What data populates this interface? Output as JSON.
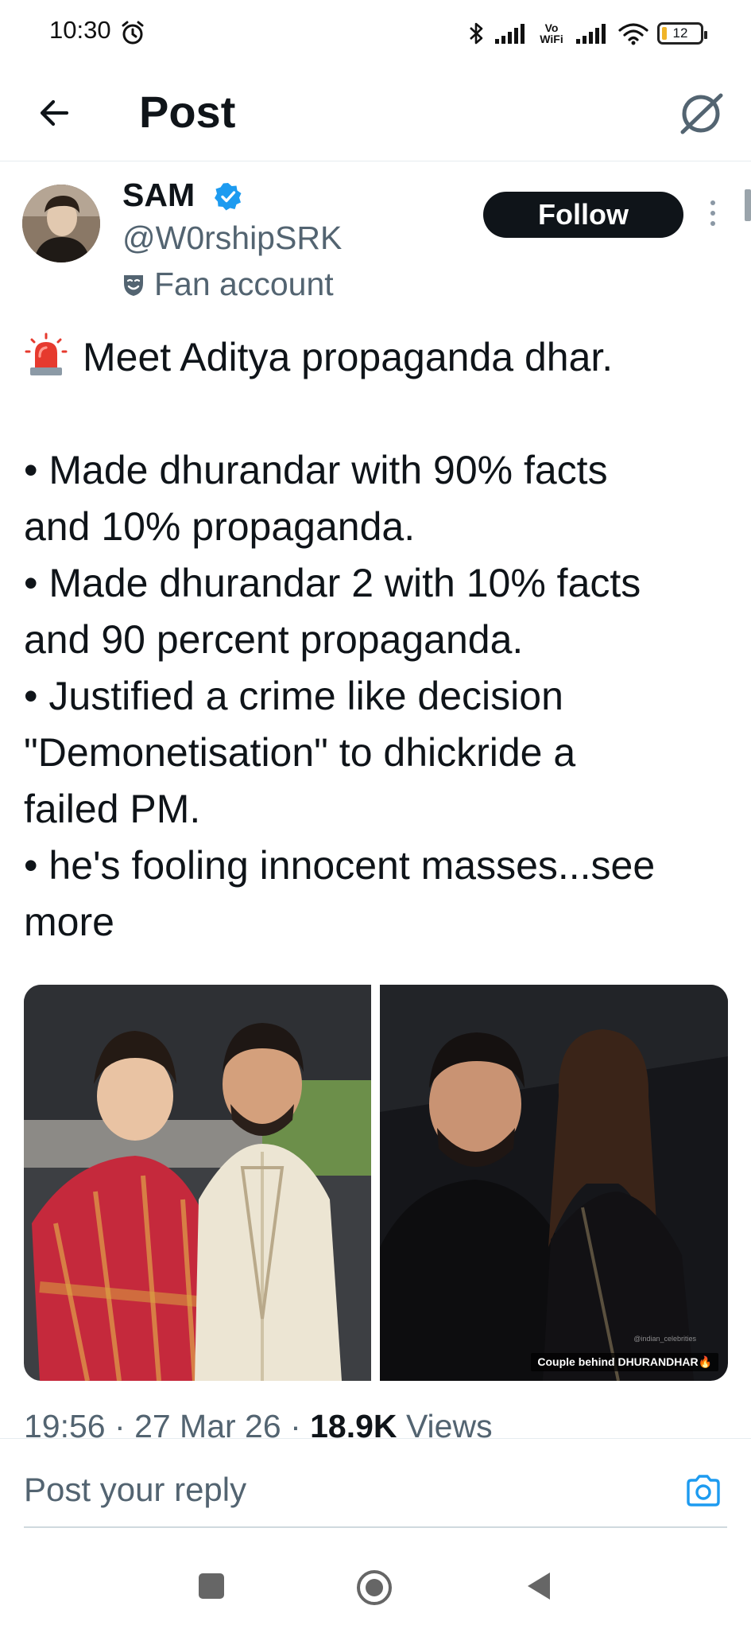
{
  "status_bar": {
    "time": "10:30",
    "network_label": "Vo WiFi",
    "battery": "12"
  },
  "header": {
    "title": "Post"
  },
  "post": {
    "author": {
      "name": "SAM",
      "handle": "@W0rshipSRK",
      "label": "Fan account",
      "verified": true
    },
    "follow_label": "Follow",
    "lines": [
      "Meet Aditya propaganda dhar.",
      "• Made dhurandar with 90% facts",
      "and 10% propaganda.",
      "• Made dhurandar 2 with 10% facts",
      "and 90 percent propaganda.",
      "• Justified a crime like decision",
      "\"Demonetisation\" to dhickride a",
      "failed PM.",
      "• he's fooling innocent masses...see",
      "more"
    ],
    "media_caption": "Couple behind DHURANDHAR🔥",
    "media_watermark": "@indian_celebrities",
    "meta": {
      "time": "19:56",
      "date": "27 Mar 26",
      "views_count": "18.9K",
      "views_label": "Views"
    }
  },
  "reply": {
    "placeholder": "Post your reply"
  },
  "colors": {
    "text": "#0f1419",
    "secondary": "#536471",
    "accent": "#1d9bf0",
    "follow_bg": "#0f1419"
  },
  "icons": [
    "back-arrow-icon",
    "grok-icon",
    "verified-badge-icon",
    "fan-mask-icon",
    "more-icon",
    "siren-icon",
    "camera-icon"
  ]
}
